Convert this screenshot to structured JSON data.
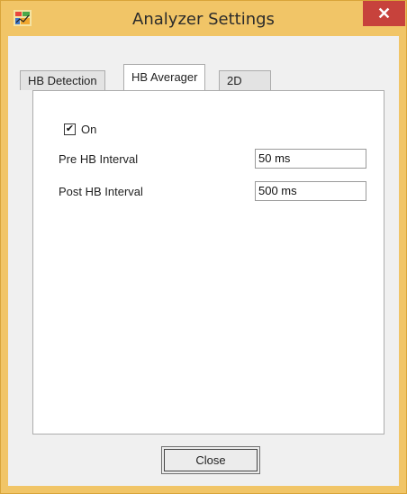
{
  "window": {
    "title": "Analyzer Settings",
    "close_glyph": "✕",
    "accent_color": "#f1c567",
    "close_color": "#c7423c"
  },
  "tabs": [
    {
      "label": "HB Detection",
      "active": false
    },
    {
      "label": "HB Averager",
      "active": true
    },
    {
      "label": "2D",
      "active": false
    }
  ],
  "averager": {
    "on_label": "On",
    "on_checked": true,
    "check_glyph": "✔",
    "pre_label": "Pre HB Interval",
    "pre_value": "50 ms",
    "post_label": "Post HB Interval",
    "post_value": "500 ms",
    "spin_up_glyph": "▲",
    "spin_down_glyph": "▼"
  },
  "footer": {
    "close_label": "Close"
  }
}
